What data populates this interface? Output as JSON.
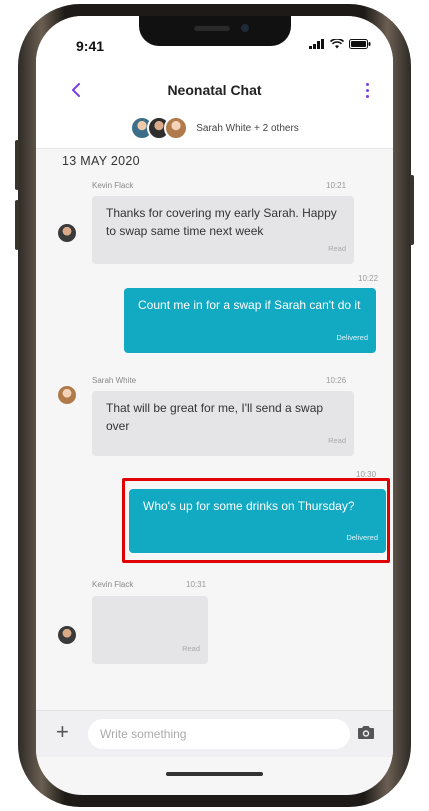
{
  "status_bar": {
    "time": "9:41"
  },
  "header": {
    "title": "Neonatal Chat",
    "participants": "Sarah White + 2 others"
  },
  "date_separator": "13 MAY 2020",
  "messages": [
    {
      "sender": "Kevin Flack",
      "time": "10:21",
      "text": "Thanks for covering my early Sarah. Happy to swap same time next week",
      "status": "Read",
      "direction": "in"
    },
    {
      "sender": "",
      "time": "10:22",
      "text": "Count me in for a swap if Sarah can't do it",
      "status": "Delivered",
      "direction": "out"
    },
    {
      "sender": "Sarah White",
      "time": "10:26",
      "text": "That will be great for me, I'll send a swap over",
      "status": "Read",
      "direction": "in"
    },
    {
      "sender": "",
      "time": "10:30",
      "text": "Who's up for some drinks on Thursday?",
      "status": "Delivered",
      "direction": "out"
    },
    {
      "sender": "Kevin Flack",
      "time": "10:31",
      "text": "",
      "status": "Read",
      "direction": "in"
    }
  ],
  "composer": {
    "placeholder": "Write something"
  },
  "colors": {
    "accent": "#7b3fe4",
    "outgoing_bubble": "#12a9c3",
    "incoming_bubble": "#e5e5e8",
    "highlight": "#e00000"
  }
}
